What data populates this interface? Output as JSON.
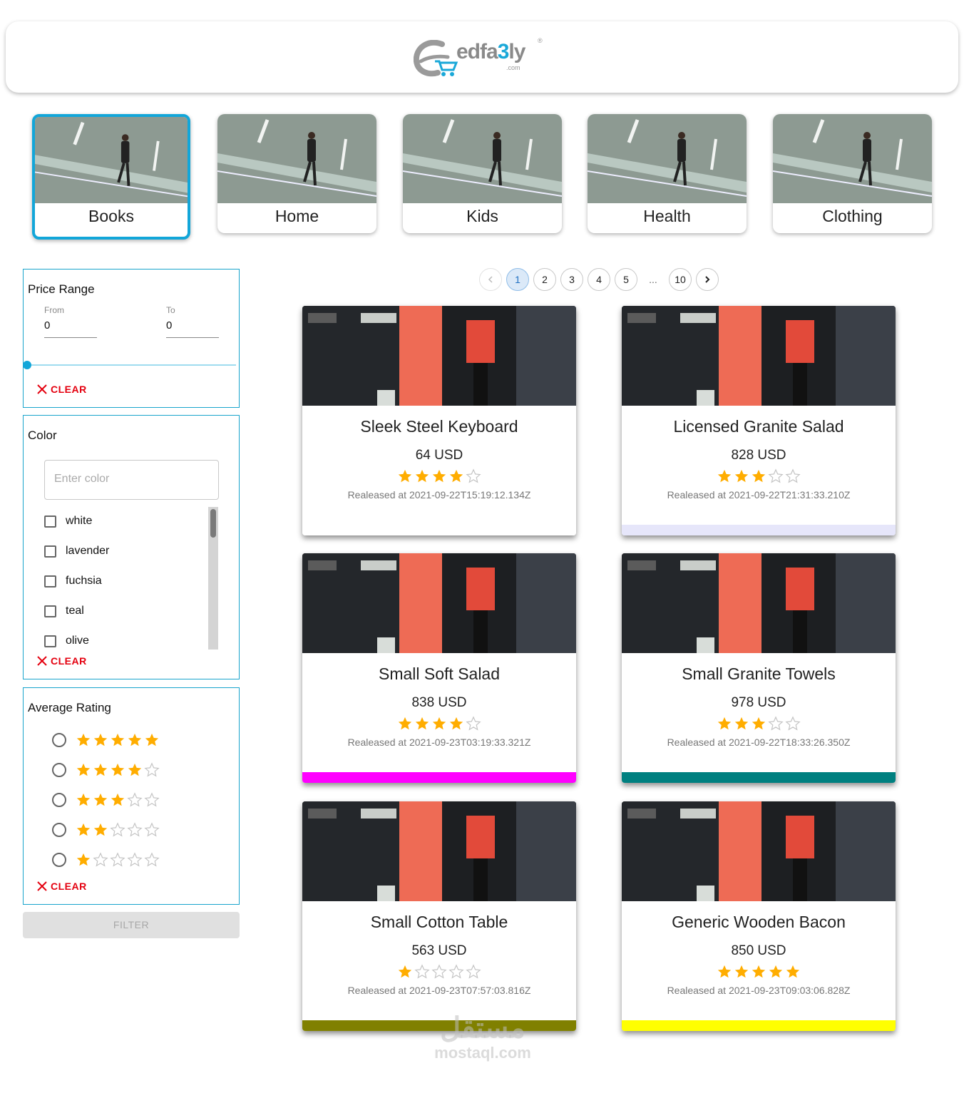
{
  "header": {
    "logo": {
      "main": "edfa",
      "accent": "3",
      "tail": "ly",
      "sub": ".com",
      "registered": "®",
      "accent_color": "#1aa8d8"
    }
  },
  "categories": [
    {
      "label": "Books",
      "active": true
    },
    {
      "label": "Home",
      "active": false
    },
    {
      "label": "Kids",
      "active": false
    },
    {
      "label": "Health",
      "active": false
    },
    {
      "label": "Clothing",
      "active": false
    }
  ],
  "filters": {
    "price": {
      "title": "Price Range",
      "from_label": "From",
      "from_value": "0",
      "to_label": "To",
      "to_value": "0",
      "slider_value": 0,
      "clear_label": "CLEAR"
    },
    "color": {
      "title": "Color",
      "placeholder": "Enter color",
      "options": [
        "white",
        "lavender",
        "fuchsia",
        "teal",
        "olive"
      ],
      "clear_label": "CLEAR"
    },
    "rating": {
      "title": "Average Rating",
      "options": [
        5,
        4,
        3,
        2,
        1
      ],
      "clear_label": "CLEAR"
    },
    "filter_button": "FILTER"
  },
  "pagination": {
    "prev_icon": "chevron-left-icon",
    "next_icon": "chevron-right-icon",
    "pages": [
      "1",
      "2",
      "3",
      "4",
      "5"
    ],
    "ellipsis": "...",
    "last_page": "10",
    "current": "1"
  },
  "products": [
    {
      "name": "Sleek Steel Keyboard",
      "price": "64 USD",
      "rating": 4,
      "released": "Realeased at 2021-09-22T15:19:12.134Z",
      "color": "#ffffff"
    },
    {
      "name": "Licensed Granite Salad",
      "price": "828 USD",
      "rating": 3,
      "released": "Realeased at 2021-09-22T21:31:33.210Z",
      "color": "#e6e6fa"
    },
    {
      "name": "Small Soft Salad",
      "price": "838 USD",
      "rating": 4,
      "released": "Realeased at 2021-09-23T03:19:33.321Z",
      "color": "#ff00ff"
    },
    {
      "name": "Small Granite Towels",
      "price": "978 USD",
      "rating": 3,
      "released": "Realeased at 2021-09-22T18:33:26.350Z",
      "color": "#008080"
    },
    {
      "name": "Small Cotton Table",
      "price": "563 USD",
      "rating": 1,
      "released": "Realeased at 2021-09-23T07:57:03.816Z",
      "color": "#808000"
    },
    {
      "name": "Generic Wooden Bacon",
      "price": "850 USD",
      "rating": 5,
      "released": "Realeased at 2021-09-23T09:03:06.828Z",
      "color": "#ffff00"
    }
  ],
  "watermark": {
    "arabic": "مستقل",
    "latin": "mostaql.com"
  },
  "colors": {
    "accent": "#12a6d9",
    "clear": "#e4000f",
    "star_filled": "#ffad00",
    "star_empty": "#c4c4c4"
  }
}
